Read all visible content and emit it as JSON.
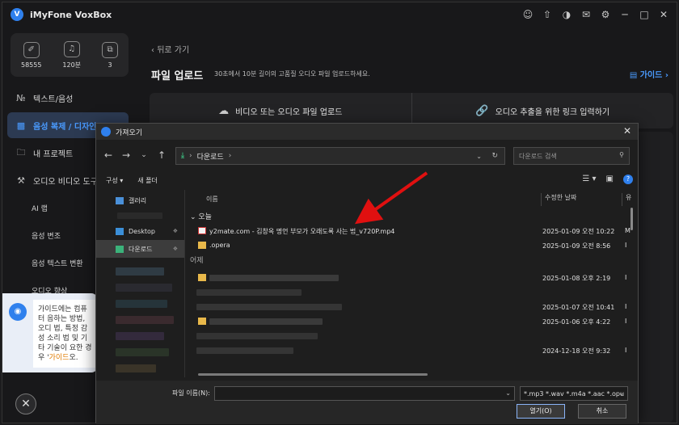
{
  "app": {
    "title": "iMyFone VoxBox",
    "logo_letter": "V"
  },
  "titlebar_icons": [
    "user-icon",
    "upload-icon",
    "gamepad-icon",
    "mail-icon",
    "settings-icon",
    "minimize-icon",
    "maximize-icon",
    "close-icon"
  ],
  "stats": [
    {
      "icon": "characters-icon",
      "value": "58555"
    },
    {
      "icon": "minutes-icon",
      "value": "120분"
    },
    {
      "icon": "clone-count-icon",
      "value": "3"
    }
  ],
  "menu": [
    {
      "label": "텍스트/음성",
      "icon": "text-speech-icon",
      "active": false
    },
    {
      "label": "음성 복제 / 디자인",
      "icon": "voice-clone-icon",
      "active": true
    },
    {
      "label": "내 프로젝트",
      "icon": "folder-icon",
      "active": false
    },
    {
      "label": "오디오 비디오 도구",
      "icon": "toolbox-icon",
      "active": false
    }
  ],
  "submenu": [
    "AI 랩",
    "음성 변조",
    "음성 텍스트 변환",
    "오디오 향상"
  ],
  "guide_bubble": {
    "text": "가이드에는 컴퓨터 음하는 방법, 오디 법, 특정 감성 소리 법 및 기타 기술이 요한 경우 '",
    "highlight": "가이드",
    "tail": "오."
  },
  "main": {
    "back_label": "뒤로 가기",
    "title": "파일 업로드",
    "subtitle": "30초에서 10분 길이의 고품질 오디오 파일 업로드하세요.",
    "guide_link": "가이드",
    "upload_video_audio": "비디오 또는 오디오 파일 업로드",
    "input_link": "오디오 추출을 위한 링크 입력하기"
  },
  "dialog": {
    "title": "가져오기",
    "path": "다운로드",
    "search_placeholder": "다운로드 검색",
    "organize": "구성",
    "new_folder": "새 폴더",
    "nav_items": [
      {
        "label": "갤러리",
        "selected": false,
        "pinned": false
      },
      {
        "label": "Desktop",
        "selected": false,
        "pinned": true
      },
      {
        "label": "다운로드",
        "selected": true,
        "pinned": true
      }
    ],
    "columns": {
      "name": "이름",
      "date": "수정한 날짜",
      "type": "유"
    },
    "groups": [
      "오늘",
      "어제"
    ],
    "files": [
      {
        "name": "y2mate.com - 김창옥 명언 부모가 오래도록 사는 법_v720P.mp4",
        "date": "2025-01-09 오전 10:22",
        "extra": "M",
        "type": "video"
      },
      {
        "name": ".opera",
        "date": "2025-01-09 오전 8:56",
        "extra": "I",
        "type": "folder"
      },
      {
        "name": "",
        "date": "2025-01-08 오후 2:19",
        "extra": "I",
        "type": "folder"
      },
      {
        "name": "",
        "date": "",
        "extra": "",
        "type": "blur"
      },
      {
        "name": "",
        "date": "2025-01-07 오전 10:41",
        "extra": "I",
        "type": "blur"
      },
      {
        "name": "",
        "date": "2025-01-06 오후 4:22",
        "extra": "I",
        "type": "folder"
      },
      {
        "name": "",
        "date": "",
        "extra": "",
        "type": "blur"
      },
      {
        "name": "",
        "date": "2024-12-18 오전 9:32",
        "extra": "I",
        "type": "blur"
      }
    ],
    "filename_label": "파일 이름(N):",
    "filename_value": "",
    "filter": "*.mp3 *.wav *.m4a *.aac *.opu",
    "open_button": "열기(O)",
    "cancel_button": "취소"
  },
  "colors": {
    "accent": "#4a9bff",
    "arrow": "#e01010",
    "download_green": "#3bb27a",
    "folder": "#e8b84a"
  }
}
